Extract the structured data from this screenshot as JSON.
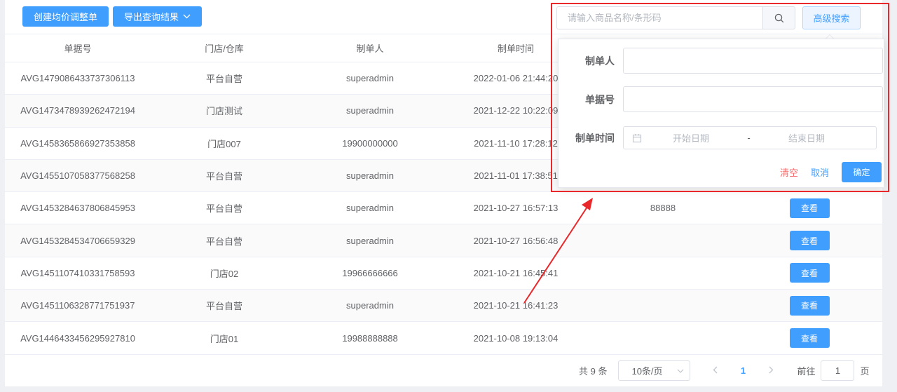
{
  "toolbar": {
    "create_label": "创建均价调整单",
    "export_label": "导出查询结果"
  },
  "search": {
    "placeholder": "请输入商品名称/条形码",
    "advanced_label": "高级搜索"
  },
  "table": {
    "columns": [
      "单据号",
      "门店/仓库",
      "制单人",
      "制单时间"
    ],
    "rows": [
      {
        "id": "AVG1479086433737306113",
        "store": "平台自营",
        "creator": "superadmin",
        "time": "2022-01-06 21:44:20",
        "extra": "",
        "action": ""
      },
      {
        "id": "AVG1473478939262472194",
        "store": "门店测试",
        "creator": "superadmin",
        "time": "2021-12-22 10:22:09",
        "extra": "",
        "action": ""
      },
      {
        "id": "AVG1458365866927353858",
        "store": "门店007",
        "creator": "19900000000",
        "time": "2021-11-10 17:28:12",
        "extra": "",
        "action": ""
      },
      {
        "id": "AVG1455107058377568258",
        "store": "平台自营",
        "creator": "superadmin",
        "time": "2021-11-01 17:38:51",
        "extra": "",
        "action": ""
      },
      {
        "id": "AVG1453284637806845953",
        "store": "平台自营",
        "creator": "superadmin",
        "time": "2021-10-27 16:57:13",
        "extra": "88888",
        "action": "查看"
      },
      {
        "id": "AVG1453284534706659329",
        "store": "平台自营",
        "creator": "superadmin",
        "time": "2021-10-27 16:56:48",
        "extra": "",
        "action": "查看"
      },
      {
        "id": "AVG1451107410331758593",
        "store": "门店02",
        "creator": "19966666666",
        "time": "2021-10-21 16:45:41",
        "extra": "",
        "action": "查看"
      },
      {
        "id": "AVG1451106328771751937",
        "store": "平台自营",
        "creator": "superadmin",
        "time": "2021-10-21 16:41:23",
        "extra": "",
        "action": "查看"
      },
      {
        "id": "AVG1446433456295927810",
        "store": "门店01",
        "creator": "19988888888",
        "time": "2021-10-08 19:13:04",
        "extra": "",
        "action": "查看"
      }
    ]
  },
  "pagination": {
    "total_label": "共 9 条",
    "page_size_label": "10条/页",
    "current_page": "1",
    "goto_prefix": "前往",
    "goto_value": "1",
    "goto_suffix": "页"
  },
  "advanced": {
    "creator_label": "制单人",
    "doc_no_label": "单据号",
    "time_label": "制单时间",
    "start_placeholder": "开始日期",
    "separator": "-",
    "end_placeholder": "结束日期",
    "clear_label": "清空",
    "cancel_label": "取消",
    "confirm_label": "确定"
  },
  "colors": {
    "primary": "#409eff",
    "danger": "#f56c6c",
    "annotation": "#e8282b"
  }
}
